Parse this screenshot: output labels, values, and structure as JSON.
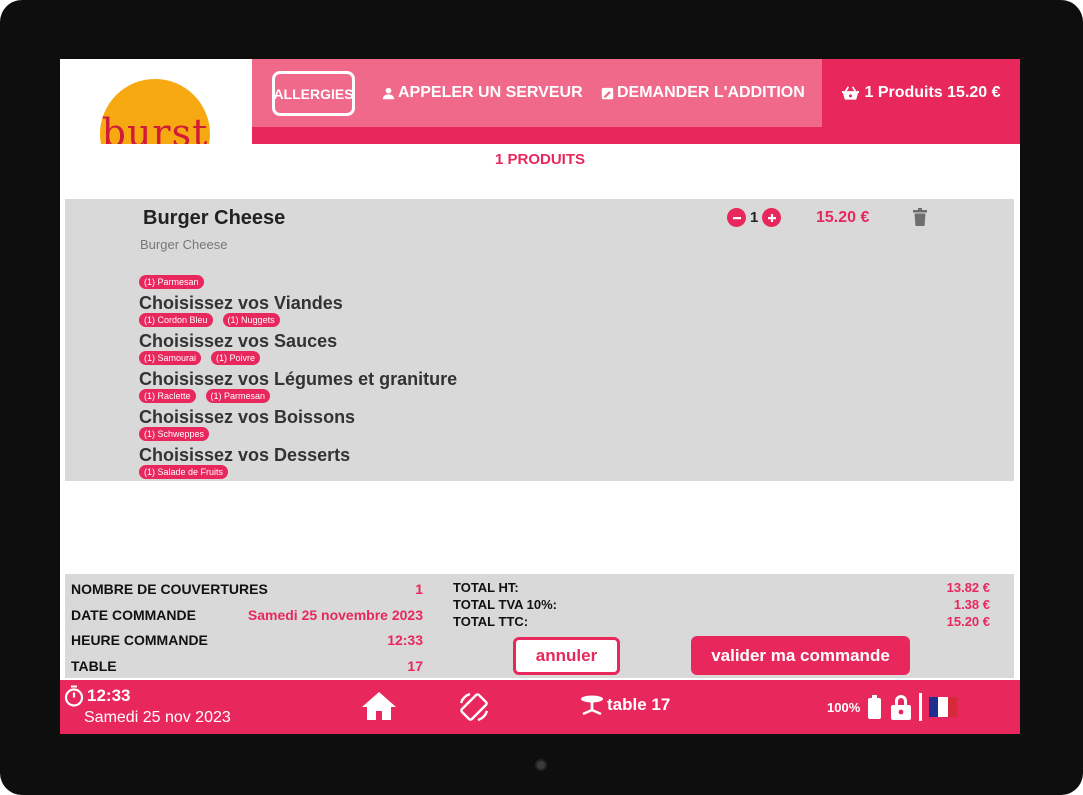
{
  "header": {
    "logo_text": "burst",
    "allergies_label": "ALLERGIES",
    "call_waiter_label": "APPELER UN SERVEUR",
    "request_bill_label": "DEMANDER L'ADDITION",
    "cart_label": "1 Produits 15.20 €"
  },
  "cart": {
    "title": "1 PRODUITS",
    "item": {
      "name": "Burger Cheese",
      "subtitle": "Burger Cheese",
      "quantity": "1",
      "price": "15.20 €",
      "base_options": [
        "(1) Parmesan"
      ],
      "groups": [
        {
          "title": "Choisissez vos Viandes",
          "options": [
            "(1) Cordon Bleu",
            "(1) Nuggets"
          ]
        },
        {
          "title": "Choisissez vos Sauces",
          "options": [
            "(1) Samourai",
            "(1) Poivre"
          ]
        },
        {
          "title": "Choisissez vos Légumes et graniture",
          "options": [
            "(1) Raclette",
            "(1) Parmesan"
          ]
        },
        {
          "title": "Choisissez vos Boissons",
          "options": [
            "(1) Schweppes"
          ]
        },
        {
          "title": "Choisissez vos Desserts",
          "options": [
            "(1) Salade de Fruits"
          ]
        }
      ]
    }
  },
  "summary": {
    "info": [
      {
        "label": "NOMBRE DE COUVERTURES",
        "value": "1"
      },
      {
        "label": "DATE COMMANDE",
        "value": "Samedi 25 novembre 2023"
      },
      {
        "label": "HEURE COMMANDE",
        "value": "12:33"
      },
      {
        "label": "TABLE",
        "value": "17"
      }
    ],
    "totals": [
      {
        "label": "TOTAL HT:",
        "value": "13.82 €"
      },
      {
        "label": "TOTAL TVA 10%:",
        "value": "1.38 €"
      },
      {
        "label": "TOTAL TTC:",
        "value": "15.20 €"
      }
    ],
    "cancel_label": "annuler",
    "confirm_label": "valider ma commande"
  },
  "footer": {
    "time": "12:33",
    "date": "Samedi 25 nov 2023",
    "table_label": "table 17",
    "battery": "100%"
  },
  "colors": {
    "accent": "#e8285c",
    "header_light": "#f0688a",
    "panel_gray": "#d9d9d9",
    "logo_orange": "#f7a912"
  },
  "icons": [
    "person-icon",
    "receipt-icon",
    "basket-icon",
    "minus-icon",
    "plus-icon",
    "trash-icon",
    "stopwatch-icon",
    "home-icon",
    "rotate-icon",
    "table-icon",
    "battery-icon",
    "lock-icon",
    "france-flag-icon"
  ]
}
